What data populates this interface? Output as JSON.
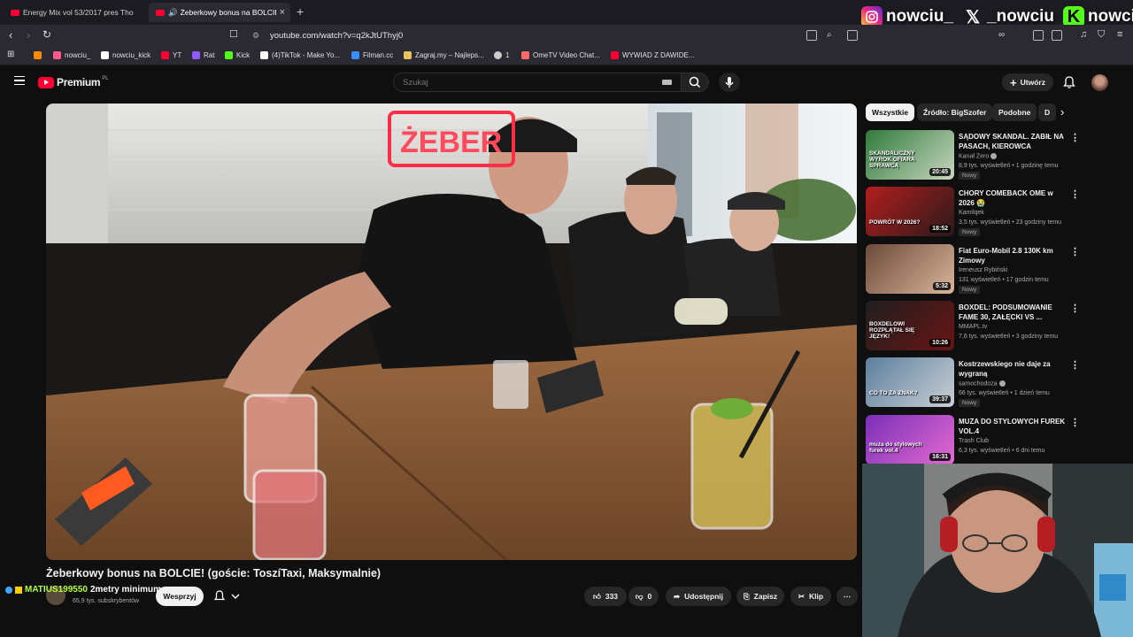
{
  "browser": {
    "tabs": [
      {
        "label": "Energy Mix vol 53/2017 pres Tho"
      },
      {
        "label": "Żeberkowy bonus na BOLCIE!"
      }
    ],
    "url": "youtube.com/watch?v=q2kJtUThyj0",
    "bookmarks": [
      {
        "label": "nowciu_",
        "color": "#ff5a8a"
      },
      {
        "label": "nowciu_kick",
        "color": "#ffffff"
      },
      {
        "label": "YT",
        "color": "#ff0033"
      },
      {
        "label": "Rat",
        "color": "#8e5cff"
      },
      {
        "label": "Kick",
        "color": "#53fc18"
      },
      {
        "label": "(4)TikTok - Make Yo...",
        "color": "#ffffff"
      },
      {
        "label": "Filman.cc",
        "color": "#3a8cff"
      },
      {
        "label": "Zagraj.my – Najleps...",
        "color": "#e5c25a"
      },
      {
        "label": "1",
        "color": "#cccccc"
      },
      {
        "label": "OmeTV Video Chat...",
        "color": "#ff6a6a"
      },
      {
        "label": "WYWIAD Z DAWIDE...",
        "color": "#ff0033"
      }
    ]
  },
  "socials": [
    {
      "icon": "instagram-icon",
      "handle": "nowciu_"
    },
    {
      "icon": "x-icon",
      "handle": "_nowciu"
    },
    {
      "icon": "kick-icon",
      "handle": "nowciu"
    }
  ],
  "header": {
    "logo": "Premium",
    "logo_country": "PL",
    "search_placeholder": "Szukaj",
    "create_label": "Utwórz"
  },
  "video": {
    "title": "Żeberkowy bonus na BOLCIE! (goście: ToszíTaxi, Maksymalnie)",
    "restaurant_sign": "ŻEBER",
    "subscribers": "65,9 tys. subskrybentów",
    "join_label": "Wesprzyj",
    "likes": "333",
    "dislikes": "0",
    "share_label": "Udostępnij",
    "save_label": "Zapisz",
    "clip_label": "Klip"
  },
  "chat_overlay": {
    "user": "MATIUS199550",
    "message": "2metry minimum"
  },
  "chips": [
    "Wszystkie",
    "Źródło: BigSzofer",
    "Podobne",
    "D"
  ],
  "recommendations": [
    {
      "title": "SĄDOWY SKANDAL. ZABIŁ NA PASACH, KIEROWCA NIEWINNY",
      "channel": "Kanał Zero",
      "verified": true,
      "meta": "8,9 tys. wyświetleń • 1 godzinę temu",
      "badge": "Nowy",
      "duration": "20:45",
      "thumb_colors": [
        "#2f7a3a",
        "#c8d6c0"
      ]
    },
    {
      "title": "CHORY COMEBACK OME w 2026 😭",
      "channel": "Kamilqek",
      "verified": false,
      "meta": "3,5 tys. wyświetleń • 23 godziny temu",
      "badge": "Nowy",
      "duration": "18:52",
      "thumb_colors": [
        "#b31e1e",
        "#2a1a1a"
      ]
    },
    {
      "title": "Fiat Euro-Mobil 2.8 130K km Zimowy",
      "channel": "Ireneusz Rybiński",
      "verified": false,
      "meta": "131 wyświetleń • 17 godzin temu",
      "badge": "Nowy",
      "duration": "5:32",
      "thumb_colors": [
        "#6b4a3a",
        "#d9b59a"
      ]
    },
    {
      "title": "BOXDEL: PODSUMOWANIE FAME 30, ZAŁĘCKI VS ...",
      "channel": "MMAPL.tv",
      "verified": false,
      "meta": "7,6 tys. wyświetleń • 3 godziny temu",
      "badge": "",
      "duration": "10:26",
      "thumb_colors": [
        "#1f1f1f",
        "#6a1414"
      ]
    },
    {
      "title": "Kostrzewskiego nie daje za wygraną",
      "channel": "samochodoza",
      "verified": true,
      "meta": "66 tys. wyświetleń • 1 dzień temu",
      "badge": "Nowy",
      "duration": "39:37",
      "thumb_colors": [
        "#5c7f9e",
        "#c9cfd4"
      ]
    },
    {
      "title": "MUZA DO STYLOWYCH FUREK VOL.4",
      "channel": "Trash Club",
      "verified": false,
      "meta": "6,3 tys. wyświetleń • 6 dni temu",
      "badge": "",
      "duration": "16:31",
      "thumb_colors": [
        "#7a2fb8",
        "#e36ad1"
      ]
    }
  ],
  "thumb_texts": [
    "SKANDALICZNY WYROK OFIARA SPRAWCĄ",
    "POWRÓT W 2026?",
    "",
    "BOXDELOWI ROZPLĄTAŁ SIĘ JĘZYK!",
    "CO TO ZA ZNAK?",
    "muza do stylowych furek vol.4"
  ],
  "colors": {
    "accent": "#ff0033",
    "bg": "#0f0f0f",
    "chip": "#272727"
  }
}
